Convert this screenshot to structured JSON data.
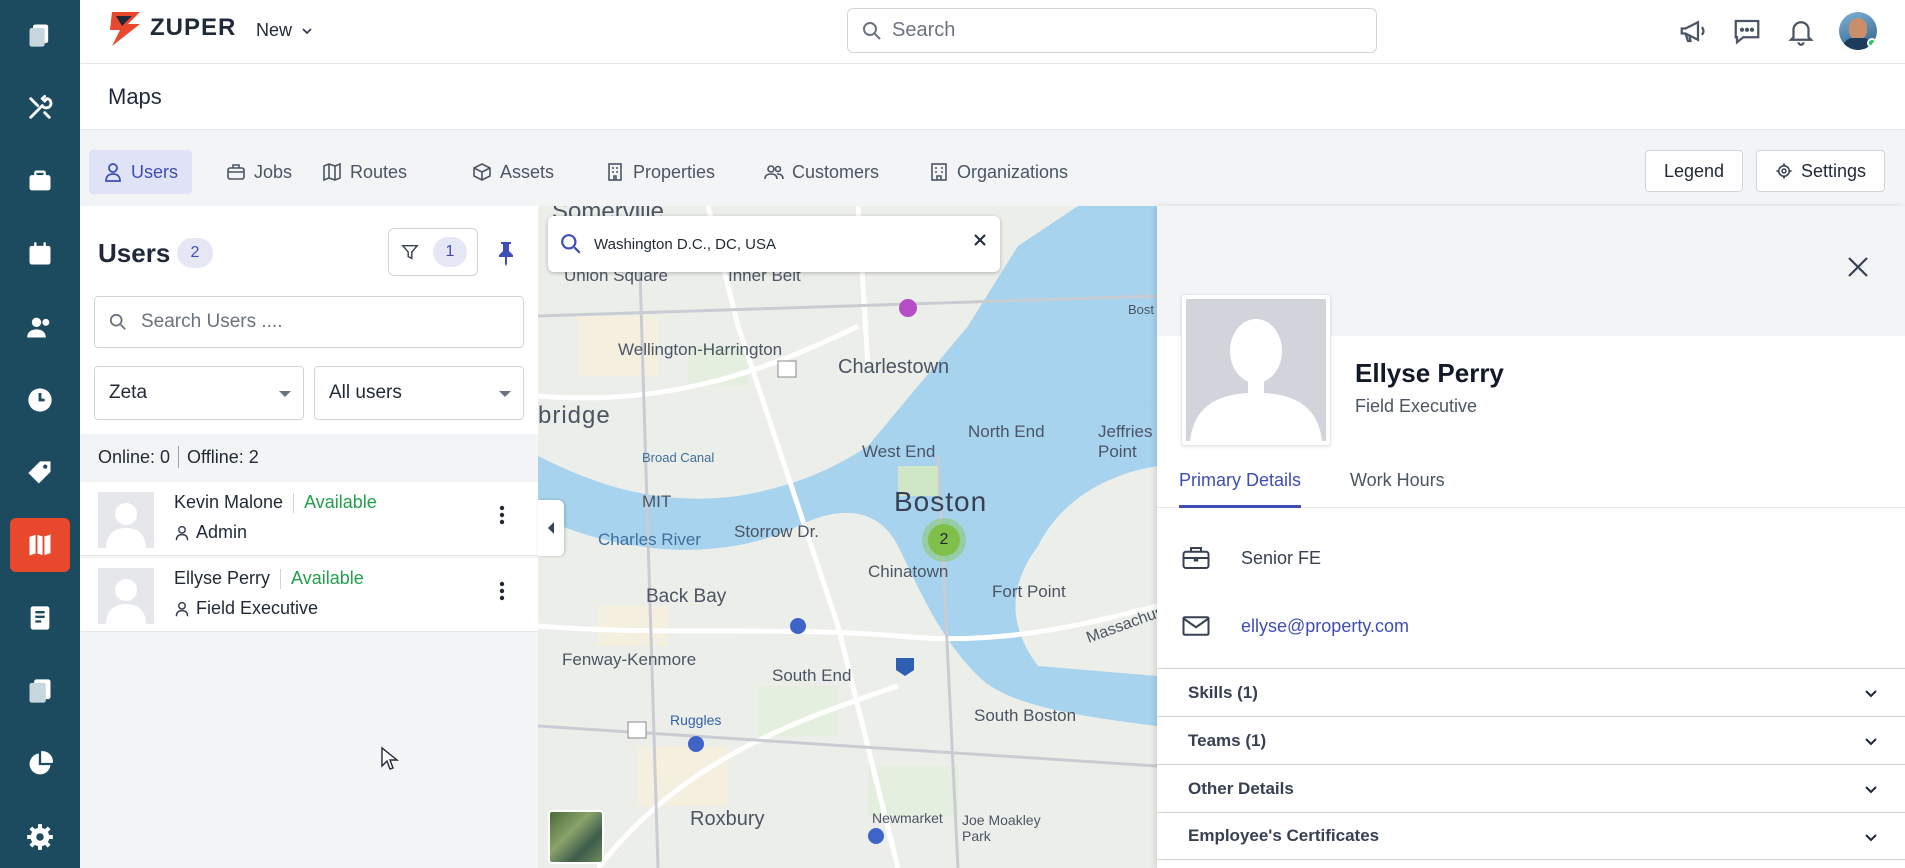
{
  "app": {
    "logo_text": "ZUPER",
    "new_label": "New"
  },
  "search": {
    "placeholder": "Search"
  },
  "page": {
    "title": "Maps"
  },
  "tabs": [
    {
      "label": "Users",
      "icon": "user-icon",
      "active": true
    },
    {
      "label": "Jobs",
      "icon": "briefcase-icon"
    },
    {
      "label": "Routes",
      "icon": "map-icon"
    },
    {
      "label": "Assets",
      "icon": "box-icon"
    },
    {
      "label": "Properties",
      "icon": "building-icon"
    },
    {
      "label": "Customers",
      "icon": "customers-icon"
    },
    {
      "label": "Organizations",
      "icon": "organization-icon"
    }
  ],
  "actions": {
    "legend_label": "Legend",
    "settings_label": "Settings"
  },
  "users_panel": {
    "title": "Users",
    "count": "2",
    "filter_count": "1",
    "search_placeholder": "Search Users ....",
    "team_select": "Zeta",
    "user_select": "All users",
    "online": "Online: 0",
    "offline": "Offline: 2",
    "users": [
      {
        "name": "Kevin Malone",
        "status": "Available",
        "role": "Admin"
      },
      {
        "name": "Ellyse Perry",
        "status": "Available",
        "role": "Field Executive"
      }
    ]
  },
  "map": {
    "search_value": "Washington D.C., DC, USA",
    "cluster_count": "2",
    "labels": [
      "Somerville",
      "Union Square",
      "Inner Belt",
      "Wellington-Harrington",
      "Charlestown",
      "bridge",
      "North End",
      "Jeffries Point",
      "West End",
      "MIT",
      "Boston",
      "Charles River",
      "Storrow Dr.",
      "Chinatown",
      "Back Bay",
      "Fort Point",
      "Fenway-Kenmore",
      "South End",
      "Ruggles",
      "Roxbury",
      "Newmarket",
      "South Boston",
      "Joe Moakley Park",
      "Massachusetts",
      "Broad Canal",
      "Bost"
    ]
  },
  "details": {
    "name": "Ellyse Perry",
    "role": "Field Executive",
    "tabs": [
      "Primary Details",
      "Work Hours"
    ],
    "designation": "Senior FE",
    "email": "ellyse@property.com",
    "sections": [
      "Skills (1)",
      "Teams (1)",
      "Other Details",
      "Employee's Certificates"
    ]
  },
  "colors": {
    "rail": "#1c4a5e",
    "rail_active": "#e8492c",
    "accent": "#3f4db8",
    "available": "#22a04b"
  }
}
